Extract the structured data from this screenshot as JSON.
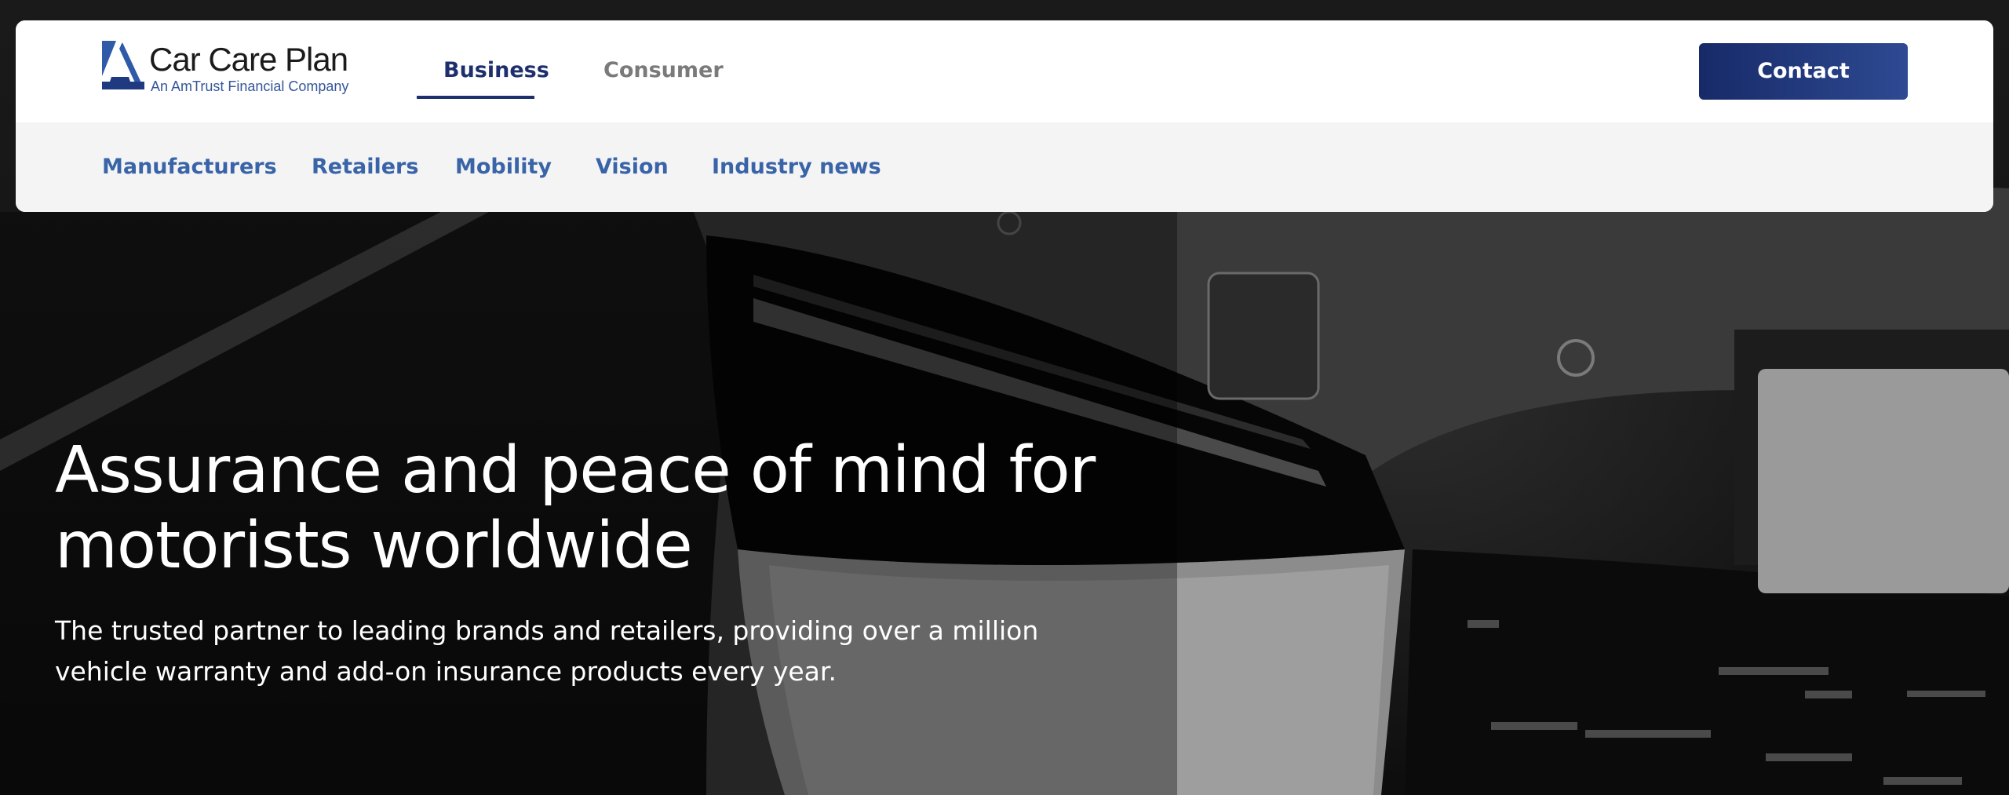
{
  "brand": {
    "name": "Car Care Plan",
    "tagline": "An AmTrust Financial Company",
    "logo_icon": "triangle-a-logo",
    "colors": {
      "navy": "#1e2f6e",
      "link_blue": "#3a64a8",
      "logo_blue": "#34569b"
    }
  },
  "main_nav": {
    "tabs": [
      {
        "label": "Business",
        "state": "active"
      },
      {
        "label": "Consumer",
        "state": "inactive"
      }
    ],
    "contact_label": "Contact"
  },
  "sub_nav": {
    "items": [
      {
        "label": "Manufacturers"
      },
      {
        "label": "Retailers"
      },
      {
        "label": "Mobility"
      },
      {
        "label": "Vision"
      },
      {
        "label": "Industry news"
      }
    ]
  },
  "hero": {
    "title": "Assurance and peace of mind for motorists worldwide",
    "subtitle": "The trusted partner to leading brands and retailers, providing over a million vehicle warranty and add-on insurance products every year."
  }
}
